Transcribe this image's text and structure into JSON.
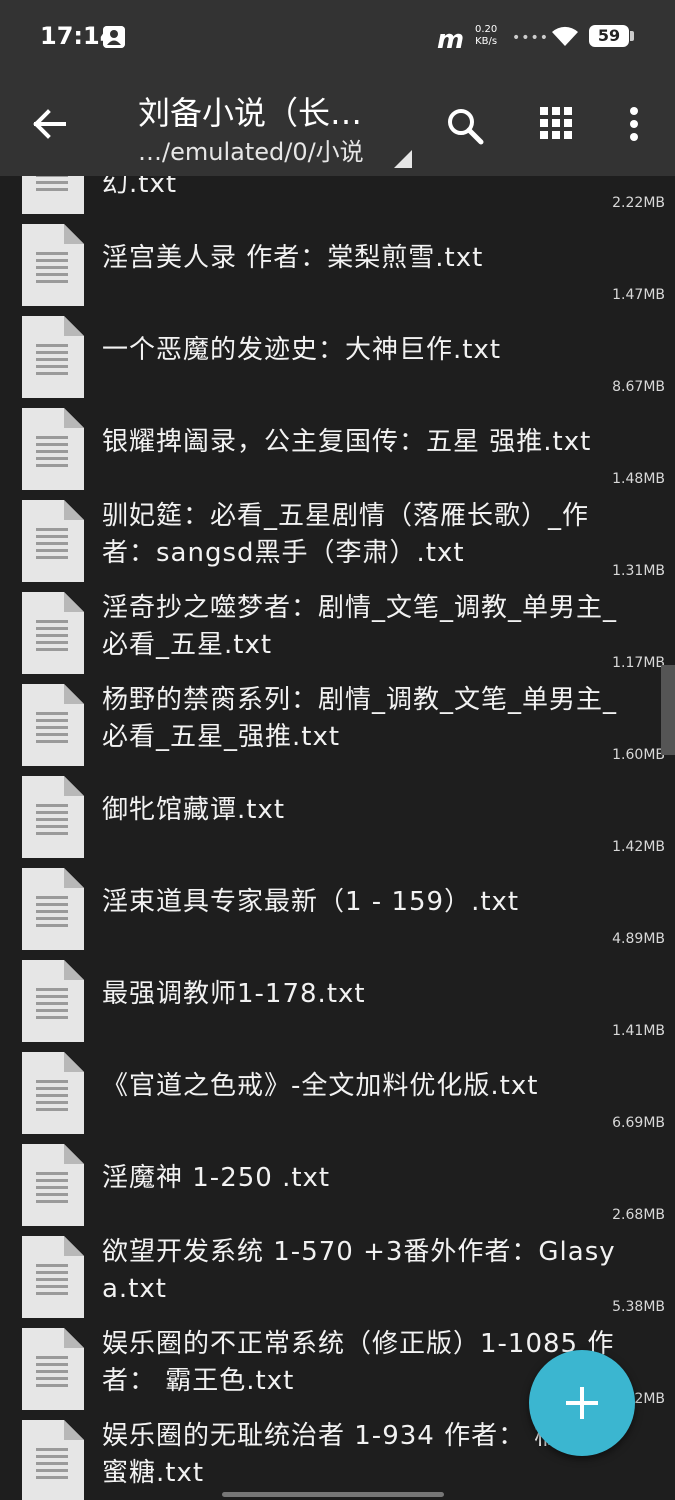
{
  "status_bar": {
    "time": "17:14",
    "net_speed_value": "0.20",
    "net_speed_unit": "KB/s",
    "battery": "59"
  },
  "toolbar": {
    "title": "刘备小说（长…",
    "path": "…/emulated/0/小说",
    "icons": [
      "back-arrow-icon",
      "search-icon",
      "grid-view-icon",
      "more-vert-icon"
    ]
  },
  "files": [
    {
      "name": "幻.txt",
      "size": "2.22MB"
    },
    {
      "name": "淫宫美人录 作者：棠梨煎雪.txt",
      "size": "1.47MB"
    },
    {
      "name": "一个恶魔的发迹史：大神巨作.txt",
      "size": "8.67MB"
    },
    {
      "name": "银耀捭阖录，公主复国传：五星 强推.txt",
      "size": "1.48MB"
    },
    {
      "name": "驯妃筵：必看_五星剧情（落雁长歌）_作者：sangsd黑手（李肃）.txt",
      "size": "1.31MB"
    },
    {
      "name": "淫奇抄之噬梦者：剧情_文笔_调教_单男主_必看_五星.txt",
      "size": "1.17MB"
    },
    {
      "name": "杨野的禁脔系列：剧情_调教_文笔_单男主_必看_五星_强推.txt",
      "size": "1.60MB"
    },
    {
      "name": "御牝馆藏谭.txt",
      "size": "1.42MB"
    },
    {
      "name": "淫束道具专家最新（1 - 159）.txt",
      "size": "4.89MB"
    },
    {
      "name": "最强调教师1-178.txt",
      "size": "1.41MB"
    },
    {
      "name": "《官道之色戒》-全文加料优化版.txt",
      "size": "6.69MB"
    },
    {
      "name": "淫魔神  1-250 .txt",
      "size": "2.68MB"
    },
    {
      "name": "欲望开发系统 1-570 +3番外作者：Glasya.txt",
      "size": "5.38MB"
    },
    {
      "name": "娱乐圈的不正常系统（修正版）1-1085 作者： 霸王色.txt",
      "size": "02MB"
    },
    {
      "name": "娱乐圈的无耻统治者 1-934 作者： 橘子加蜜糖.txt",
      "size": ""
    }
  ],
  "fab": {
    "icon": "add-icon"
  },
  "colors": {
    "bar": "#333333",
    "background": "#1e1e1e",
    "fab": "#3bb6d0"
  }
}
